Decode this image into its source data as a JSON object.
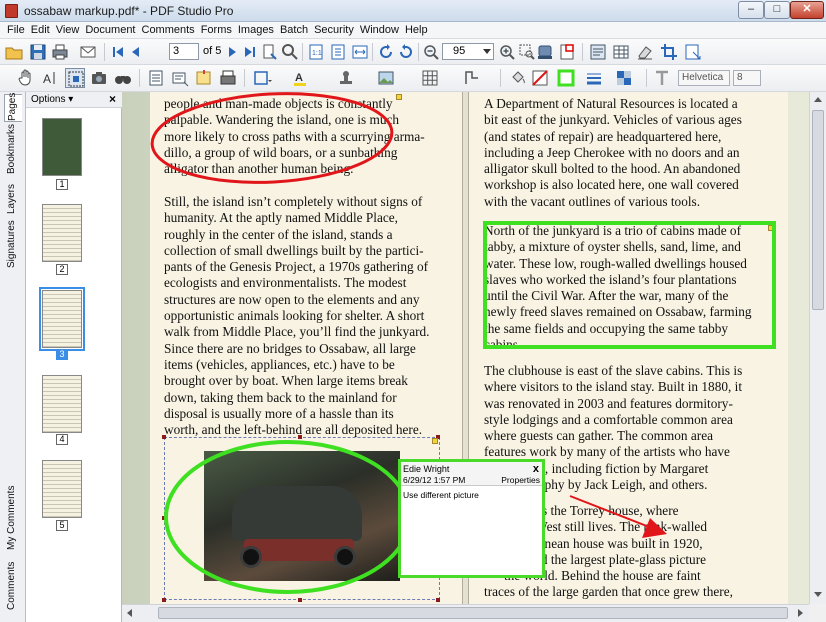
{
  "window": {
    "title": "ossabaw markup.pdf* - PDF Studio Pro",
    "minimize": "–",
    "maximize": "□",
    "close": "✕"
  },
  "menu": [
    "File",
    "Edit",
    "View",
    "Document",
    "Comments",
    "Forms",
    "Images",
    "Batch",
    "Security",
    "Window",
    "Help"
  ],
  "toolbar": {
    "page_value": "3",
    "page_of": "of 5",
    "zoom_value": "95",
    "font_name": "Helvetica",
    "font_size": "8"
  },
  "side_tabs": [
    "Pages",
    "Bookmarks",
    "Layers",
    "Signatures",
    "My Comments",
    "Comments"
  ],
  "thumbnails": {
    "options_label": "Options",
    "close": "×",
    "pages": [
      "1",
      "2",
      "3",
      "4",
      "5"
    ],
    "selected": "3"
  },
  "document": {
    "left_paragraphs": [
      "people and man-made objects is constantly\npalpable. Wandering the island, one is much\nmore likely to cross paths with a scurrying arma-\ndillo, a group of wild boars, or a sunbathing\nalligator than another human being.",
      "Still, the island isn’t completely without signs of\nhumanity. At the aptly named Middle Place,\nroughly in the center of the island, stands a\ncollection of small dwellings built by the partici-\npants of the Genesis Project, a 1970s gathering of\necologists and environmentalists. The modest\nstructures are now open to the elements and any\nopportunistic animals looking for shelter. A short\nwalk from Middle Place, you’ll find the junkyard.\nSince there are no bridges to Ossabaw, all large\nitems (vehicles, appliances, etc.) have to be\nbrought over by boat. When large items break\ndown, taking them back to the mainland for\ndisposal is usually more of a hassle than its\nworth, and the left-behind are all deposited here."
    ],
    "right_paragraphs": [
      "A Department of Natural Resources is located a\nbit east of the junkyard. Vehicles of various ages\n(and states of repair) are headquartered here,\nincluding a Jeep Cherokee with no doors and an\nalligator skull bolted to the hood. An abandoned\nworkshop is also located here, one wall covered\nwith the vacant outlines of various tools.",
      "North of the junkyard is a trio of cabins made of\ntabby, a mixture of oyster shells, sand, lime, and\nwater. These low, rough-walled dwellings housed\nslaves who worked the island’s four plantations\nuntil the Civil War. After the war, many of the\nnewly freed slaves remained on Ossabaw, farming\nthe same fields and occupying the same tabby\ncabins.",
      "The clubhouse is east of the slave cabins. This is\nwhere visitors to the island stay. Built in 1880, it\nwas renovated in 2003 and features dormitory-\nstyle lodgings and a comfortable common area\nwhere guests can gather. The common area\nfeatures work by many of the artists who have\n      e island, including fiction by Margaret\n      hotography by Jack Leigh, and others.",
      "     er east is the Torrey house, where\n      orrey West still lives. The pink-walled\n      editerranean house was built in 1920,\n      featured the largest plate-glass picture\n      the world. Behind the house are faint\ntraces of the large garden that once grew there,"
    ]
  },
  "comment_popup": {
    "author": "Edie Wright",
    "date": "6/29/12 1:57 PM",
    "close": "x",
    "properties": "Properties",
    "text": "Use different picture"
  },
  "colors": {
    "red_markup": "#e0161a",
    "green_markup": "#3ee021",
    "selection": "#3a8ee6"
  }
}
